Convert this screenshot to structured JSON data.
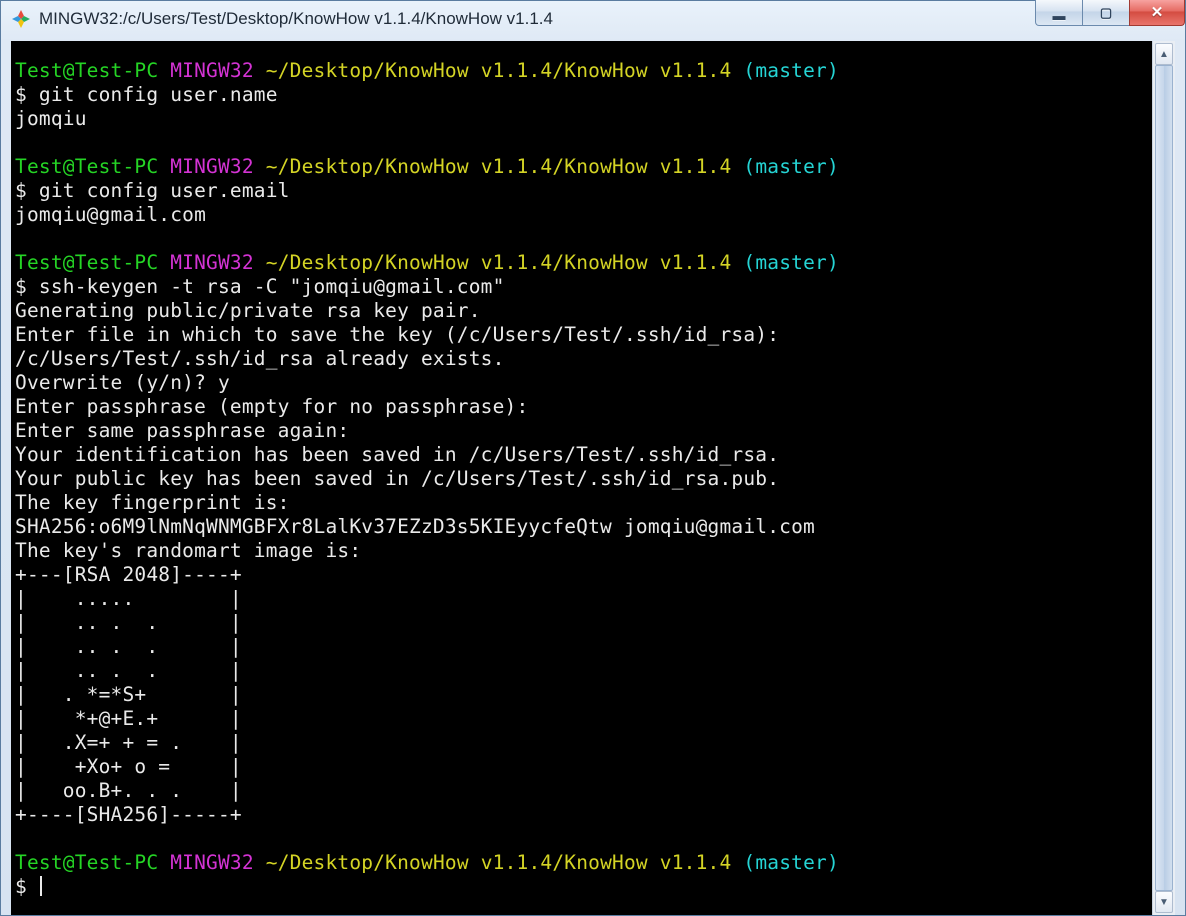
{
  "window": {
    "title": "MINGW32:/c/Users/Test/Desktop/KnowHow v1.1.4/KnowHow v1.1.4"
  },
  "colors": {
    "green": "#25d425",
    "magenta": "#d433d4",
    "yellow": "#d4d425",
    "cyan": "#25d4d4",
    "white": "#eaeaea"
  },
  "prompt": {
    "user_host": "Test@Test-PC",
    "shell": "MINGW32",
    "cwd": "~/Desktop/KnowHow v1.1.4/KnowHow v1.1.4",
    "branch_open": "(",
    "branch": "master",
    "branch_close": ")",
    "symbol": "$ "
  },
  "blocks": [
    {
      "cmd": "git config user.name",
      "out": [
        "jomqiu"
      ]
    },
    {
      "cmd": "git config user.email",
      "out": [
        "jomqiu@gmail.com"
      ]
    },
    {
      "cmd": "ssh-keygen -t rsa -C \"jomqiu@gmail.com\"",
      "out": [
        "Generating public/private rsa key pair.",
        "Enter file in which to save the key (/c/Users/Test/.ssh/id_rsa):",
        "/c/Users/Test/.ssh/id_rsa already exists.",
        "Overwrite (y/n)? y",
        "Enter passphrase (empty for no passphrase):",
        "Enter same passphrase again:",
        "Your identification has been saved in /c/Users/Test/.ssh/id_rsa.",
        "Your public key has been saved in /c/Users/Test/.ssh/id_rsa.pub.",
        "The key fingerprint is:",
        "SHA256:o6M9lNmNqWNMGBFXr8LalKv37EZzD3s5KIEyycfeQtw jomqiu@gmail.com",
        "The key's randomart image is:",
        "+---[RSA 2048]----+",
        "|    .....        |",
        "|    .. .  .      |",
        "|    .. .  .      |",
        "|    .. .  .      |",
        "|   . *=*S+       |",
        "|    *+@+E.+      |",
        "|   .X=+ + = .    |",
        "|    +Xo+ o =     |",
        "|   oo.B+. . .    |",
        "+----[SHA256]-----+"
      ]
    }
  ]
}
